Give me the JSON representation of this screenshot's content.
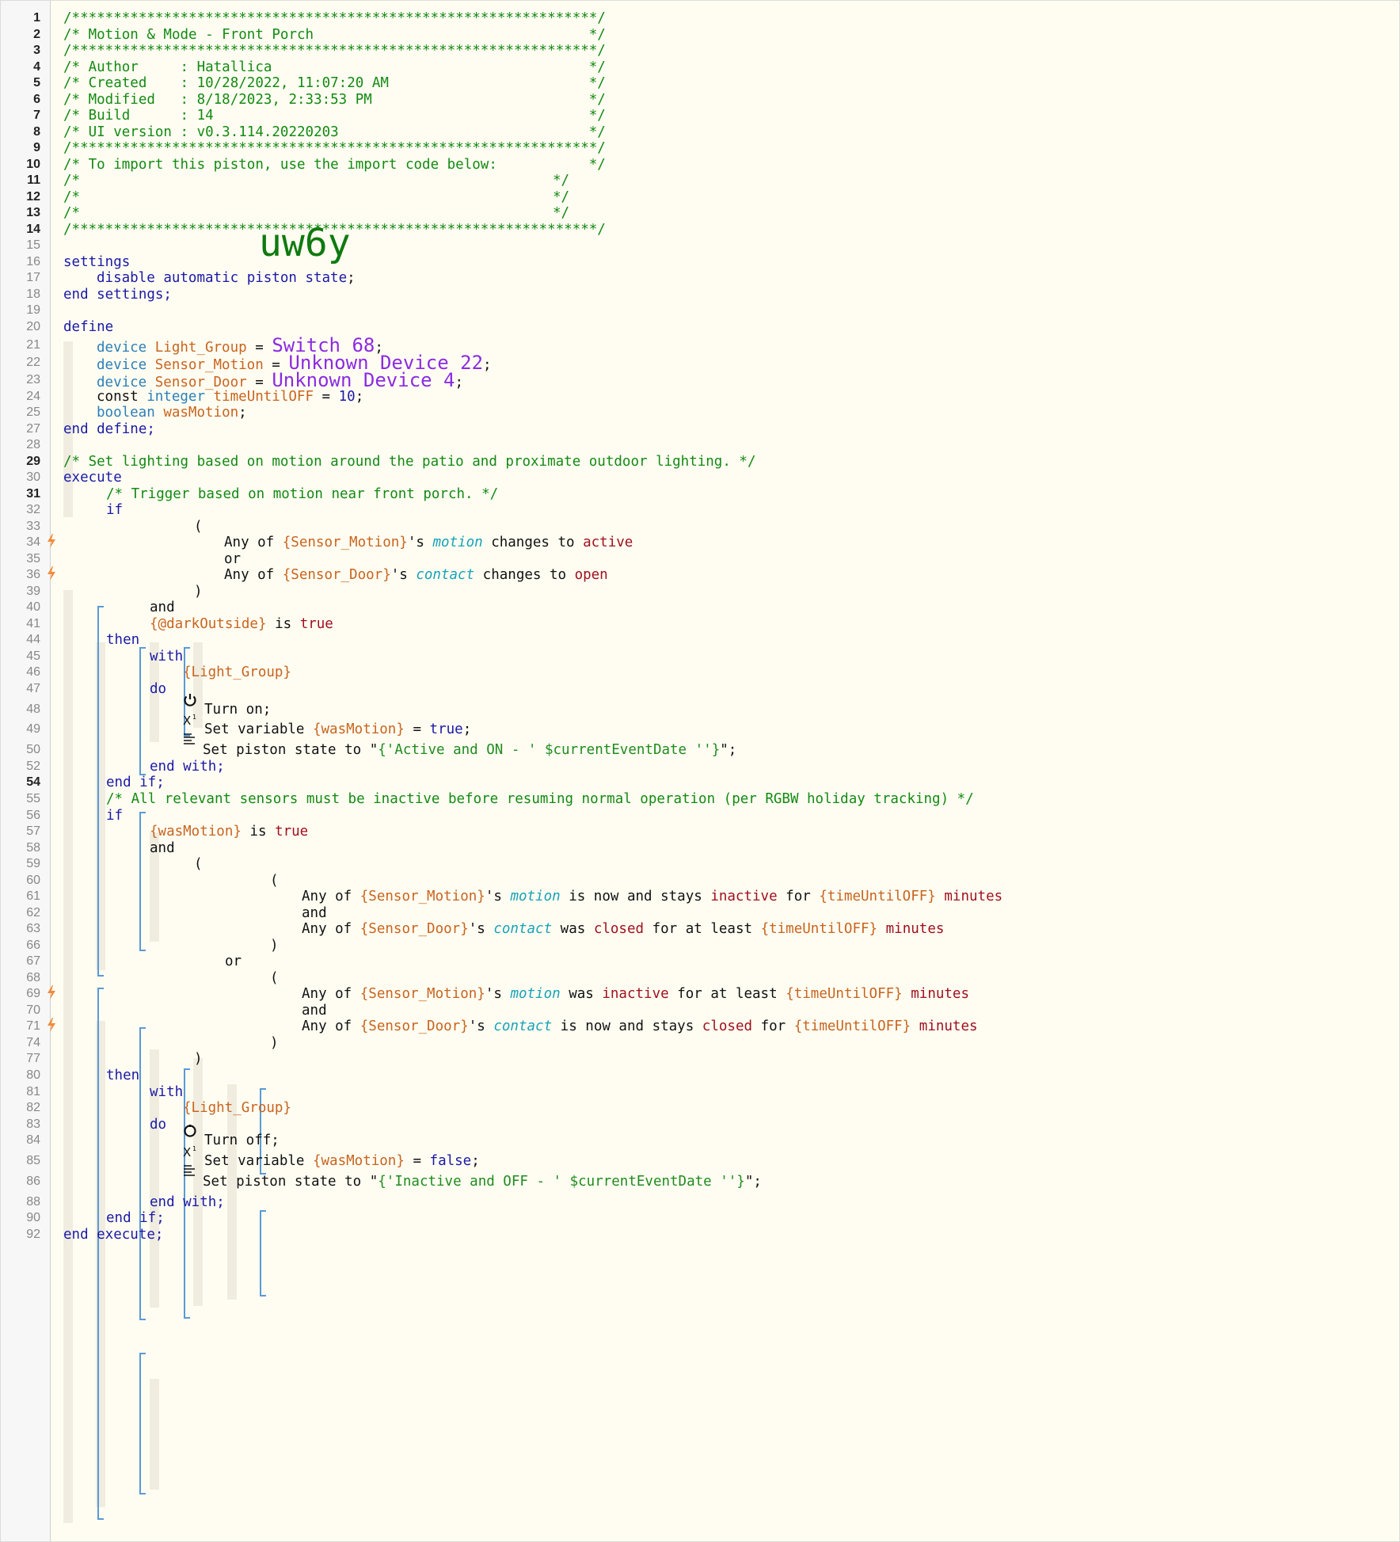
{
  "gutter": {
    "line_numbers": [
      "1",
      "2",
      "3",
      "4",
      "5",
      "6",
      "7",
      "8",
      "9",
      "10",
      "11",
      "12",
      "13",
      "14",
      "15",
      "16",
      "17",
      "18",
      "19",
      "20",
      "21",
      "22",
      "23",
      "24",
      "25",
      "27",
      "28",
      "29",
      "30",
      "31",
      "32",
      "33",
      "34",
      "35",
      "36",
      "39",
      "40",
      "41",
      "44",
      "45",
      "46",
      "47",
      "48",
      "49",
      "50",
      "52",
      "54",
      "55",
      "56",
      "57",
      "58",
      "59",
      "60",
      "61",
      "62",
      "63",
      "66",
      "67",
      "68",
      "69",
      "70",
      "71",
      "74",
      "77",
      "80",
      "81",
      "82",
      "83",
      "84",
      "85",
      "86",
      "88",
      "90",
      "92"
    ]
  },
  "header": {
    "stars_line": "/***************************************************************/",
    "title_line": "/* Motion & Mode - Front Porch                                 */",
    "author_line": "/* Author     : Hatallica                                      */",
    "created_line": "/* Created    : 10/28/2022, 11:07:20 AM                        */",
    "modified_line": "/* Modified   : 8/18/2023, 2:33:53 PM                          */",
    "build_line": "/* Build      : 14                                             */",
    "ui_version_line": "/* UI version : v0.3.114.20220203                              */",
    "import_line": "/* To import this piston, use the import code below:           */",
    "blank_comment_left": "/*",
    "blank_comment_right": "*/",
    "import_code": "uw6y"
  },
  "settings": {
    "open": "settings",
    "disable": "disable",
    "automatic": "automatic",
    "piston": "piston",
    "state": "state",
    "semi": ";",
    "close": "end settings;"
  },
  "define": {
    "open": "define",
    "close": "end define;",
    "device_kw": "device",
    "eq": "=",
    "semi": ";",
    "light_group_var": "Light_Group",
    "light_group_dev": "Switch 68",
    "sensor_motion_var": "Sensor_Motion",
    "sensor_motion_dev": "Unknown Device 22",
    "sensor_door_var": "Sensor_Door",
    "sensor_door_dev": "Unknown Device 4",
    "const_kw": "const",
    "integer_kw": "integer",
    "time_var": "timeUntilOFF",
    "time_val": "10",
    "boolean_kw": "boolean",
    "was_motion_var": "wasMotion"
  },
  "execute": {
    "comment": "/* Set lighting based on motion around the patio and proximate outdoor lighting. */",
    "open": "execute",
    "close": "end execute;",
    "if1_comment": "/* Trigger based on motion near front porch. */",
    "if_kw": "if",
    "then_kw": "then",
    "and_kw": "and",
    "or_kw": "or",
    "open_paren": "(",
    "close_paren": ")",
    "end_if": "end if;",
    "with_kw": "with",
    "do_kw": "do",
    "end_with": "end with;",
    "any_of": "Any of",
    "s_apos": "'s",
    "motion_attr": "motion",
    "contact_attr": "contact",
    "changes_to": "changes to",
    "active_val": "active",
    "open_val": "open",
    "sensor_motion_ref": "{Sensor_Motion}",
    "sensor_door_ref": "{Sensor_Door}",
    "dark_outside_ref": "{@darkOutside}",
    "is_kw": "is",
    "true_val": "true",
    "false_val": "false",
    "light_group_ref": "{Light_Group}",
    "turn_on": "Turn on;",
    "turn_off": "Turn off;",
    "set_variable": "Set variable",
    "was_motion_ref": "{wasMotion}",
    "eq": "=",
    "semi": ";",
    "set_piston_state": "Set piston state to \"",
    "on_state_expr": "{'Active and ON - ' $currentEventDate ''}",
    "off_state_expr": "{'Inactive and OFF - ' $currentEventDate ''}",
    "state_end": "\";",
    "if2_comment": "/* All relevant sensors must be inactive before resuming normal operation (per RGBW holiday tracking) */",
    "is_now_and_stays": "is now and stays",
    "inactive_val": "inactive",
    "closed_val": "closed",
    "for_kw": "for",
    "was_kw": "was",
    "for_at_least": "for at least",
    "time_ref": "{timeUntilOFF}",
    "minutes_val": "minutes"
  },
  "colors": {
    "comment": "#138a13",
    "keyword": "#1a1aa6",
    "variable": "#c8641e",
    "device": "#8b2be2",
    "attribute": "#17a2b8",
    "value": "#a0101d",
    "bracket": "#5b9ad6",
    "trigger_bolt": "#f08c3c"
  }
}
